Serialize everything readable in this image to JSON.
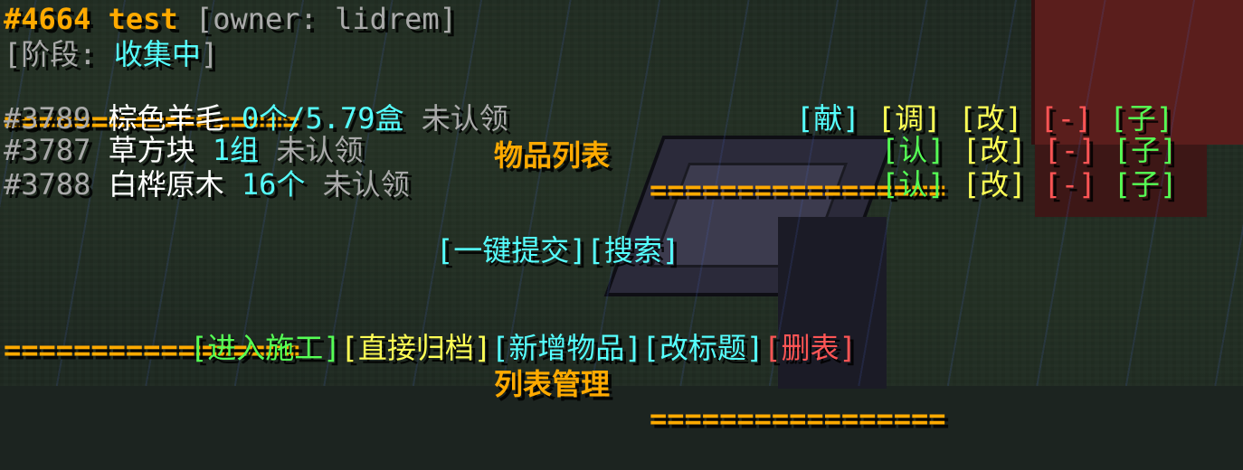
{
  "header": {
    "id": "#4664",
    "name": "test",
    "owner_open": "[",
    "owner_label": "owner:",
    "owner_name": "lidrem",
    "owner_close": "]",
    "stage_open": "[",
    "stage_label": "阶段:",
    "stage_value": "收集中",
    "stage_close": "]"
  },
  "item_section": {
    "sep_left": "=================",
    "title": "物品列表",
    "sep_right": "================="
  },
  "items": [
    {
      "id": "#3789",
      "name": "棕色羊毛",
      "qty": "0个/5.79盒",
      "status": "未认领",
      "actions": [
        {
          "label": "[献]",
          "color": "#55ffff"
        },
        {
          "label": "[调]",
          "color": "#ffff55"
        },
        {
          "label": "[改]",
          "color": "#ffff55"
        },
        {
          "label": "[-]",
          "color": "#ff5555"
        },
        {
          "label": "[子]",
          "color": "#55ff55"
        }
      ]
    },
    {
      "id": "#3787",
      "name": "草方块",
      "qty": "1组",
      "status": "未认领",
      "actions": [
        {
          "label": "[认]",
          "color": "#55ff55"
        },
        {
          "label": "[改]",
          "color": "#ffff55"
        },
        {
          "label": "[-]",
          "color": "#ff5555"
        },
        {
          "label": "[子]",
          "color": "#55ff55"
        }
      ]
    },
    {
      "id": "#3788",
      "name": "白桦原木",
      "qty": "16个",
      "status": "未认领",
      "actions": [
        {
          "label": "[认]",
          "color": "#55ff55"
        },
        {
          "label": "[改]",
          "color": "#ffff55"
        },
        {
          "label": "[-]",
          "color": "#ff5555"
        },
        {
          "label": "[子]",
          "color": "#55ff55"
        }
      ]
    }
  ],
  "quick_actions": {
    "submit_all": "[一键提交]",
    "search": "[搜索]"
  },
  "manage_section": {
    "sep_left": "=================",
    "title": "列表管理",
    "sep_right": "================="
  },
  "manage_actions": {
    "start_build": "[进入施工]",
    "archive": "[直接归档]",
    "add_item": "[新增物品]",
    "rename": "[改标题]",
    "delete": "[删表]"
  },
  "colors": {
    "orange": "#ffaa00",
    "gray": "#aaaaaa",
    "aqua": "#55ffff",
    "yellow": "#ffff55",
    "green": "#55ff55",
    "red": "#ff5555",
    "white": "#ffffff"
  }
}
